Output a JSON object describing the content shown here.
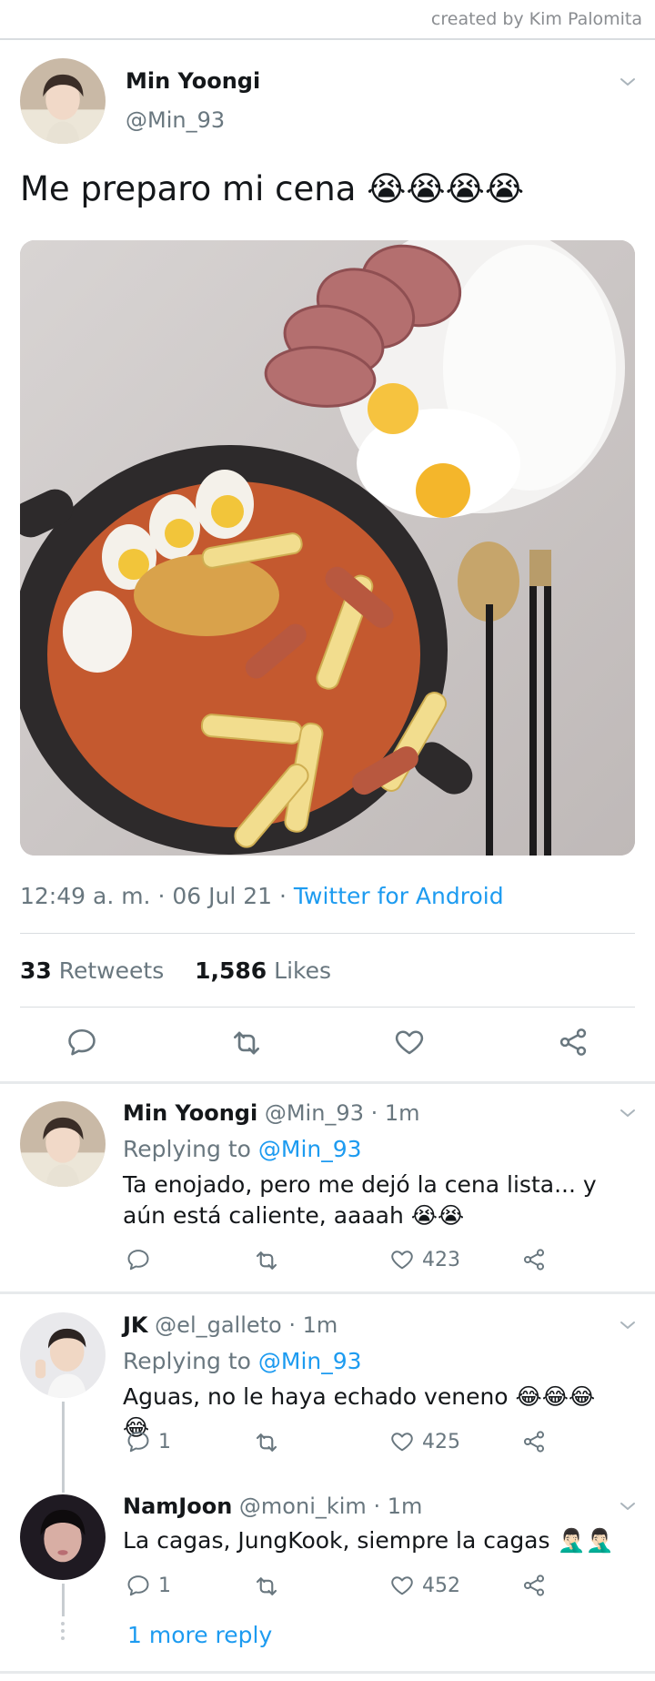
{
  "credit": "created by Kim Palomita",
  "tweet": {
    "name": "Min Yoongi",
    "handle": "@Min_93",
    "text": "Me preparo mi cena 😭😭😭😭",
    "time": "12:49 a. m. · 06 Jul 21 · ",
    "app": "Twitter for Android",
    "retweets": "33",
    "retweets_label": "Retweets",
    "likes": "1,586",
    "likes_label": "Likes",
    "actions": [
      "reply-icon",
      "retweet-icon",
      "like-icon",
      "share-icon"
    ]
  },
  "replies": [
    {
      "name": "Min Yoongi",
      "meta": "@Min_93 · 1m",
      "replying_prefix": "Replying to ",
      "replying_to": "@Min_93",
      "text": "Ta enojado, pero me dejó la cena lista... y aún está caliente, aaaah 😭😭",
      "reply_count": "",
      "like_count": "423"
    },
    {
      "name": "JK",
      "meta": "@el_galleto · 1m",
      "replying_prefix": "Replying to ",
      "replying_to": "@Min_93",
      "text": "Aguas, no le haya echado veneno 😂😂😂😂",
      "reply_count": "1",
      "like_count": "425"
    },
    {
      "name": "NamJoon",
      "meta": "@moni_kim · 1m",
      "text": "La cagas, JungKook, siempre la cagas 🤦🏻‍♂️🤦🏻‍♂️",
      "reply_count": "1",
      "like_count": "452"
    }
  ],
  "more_replies": "1 more reply",
  "colors": {
    "link": "#1d9bf0",
    "muted": "#69777f",
    "divider": "#d9dde0"
  }
}
